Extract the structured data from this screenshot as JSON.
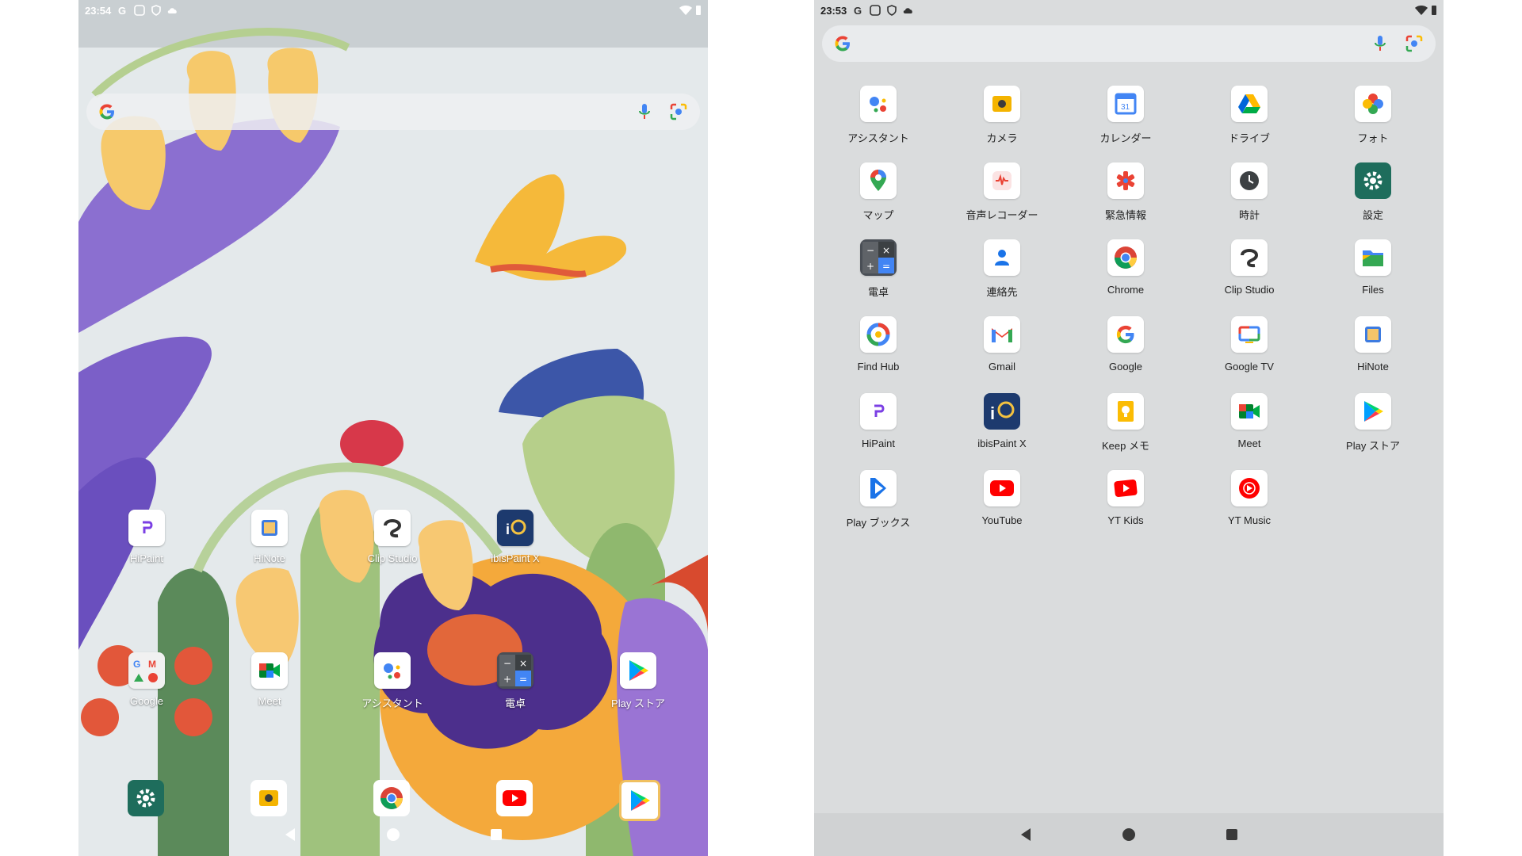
{
  "home": {
    "status_time": "23:54",
    "row1": [
      {
        "name": "hipaint",
        "label": "HiPaint",
        "icon": "hipaint-icon"
      },
      {
        "name": "hinote",
        "label": "HiNote",
        "icon": "hinote-icon"
      },
      {
        "name": "clip-studio",
        "label": "Clip Studio",
        "icon": "clip-studio-icon"
      },
      {
        "name": "ibispaint",
        "label": "ibisPaint X",
        "icon": "ibispaint-icon"
      }
    ],
    "row2": [
      {
        "name": "google-folder",
        "label": "Google",
        "icon": "google-folder-icon"
      },
      {
        "name": "meet",
        "label": "Meet",
        "icon": "meet-icon"
      },
      {
        "name": "assistant",
        "label": "アシスタント",
        "icon": "assistant-icon"
      },
      {
        "name": "calculator",
        "label": "電卓",
        "icon": "calculator-icon"
      },
      {
        "name": "play-store",
        "label": "Play ストア",
        "icon": "play-store-icon"
      }
    ],
    "dock": [
      "settings-icon",
      "camera-icon",
      "chrome-icon",
      "youtube-icon",
      "play-store-icon"
    ]
  },
  "drawer": {
    "status_time": "23:53",
    "apps": [
      {
        "label": "アシスタント",
        "icon": "assistant-icon"
      },
      {
        "label": "カメラ",
        "icon": "camera-icon"
      },
      {
        "label": "カレンダー",
        "icon": "calendar-icon"
      },
      {
        "label": "ドライブ",
        "icon": "drive-icon"
      },
      {
        "label": "フォト",
        "icon": "photos-icon"
      },
      {
        "label": "マップ",
        "icon": "maps-icon"
      },
      {
        "label": "音声レコーダー",
        "icon": "recorder-icon"
      },
      {
        "label": "緊急情報",
        "icon": "emergency-icon"
      },
      {
        "label": "時計",
        "icon": "clock-icon"
      },
      {
        "label": "設定",
        "icon": "settings-icon"
      },
      {
        "label": "電卓",
        "icon": "calculator-icon"
      },
      {
        "label": "連絡先",
        "icon": "contacts-icon"
      },
      {
        "label": "Chrome",
        "icon": "chrome-icon"
      },
      {
        "label": "Clip Studio",
        "icon": "clip-studio-icon"
      },
      {
        "label": "Files",
        "icon": "files-icon"
      },
      {
        "label": "Find Hub",
        "icon": "find-hub-icon"
      },
      {
        "label": "Gmail",
        "icon": "gmail-icon"
      },
      {
        "label": "Google",
        "icon": "google-icon"
      },
      {
        "label": "Google TV",
        "icon": "google-tv-icon"
      },
      {
        "label": "HiNote",
        "icon": "hinote-icon"
      },
      {
        "label": "HiPaint",
        "icon": "hipaint-icon"
      },
      {
        "label": "ibisPaint X",
        "icon": "ibispaint-icon"
      },
      {
        "label": "Keep メモ",
        "icon": "keep-icon"
      },
      {
        "label": "Meet",
        "icon": "meet-icon"
      },
      {
        "label": "Play ストア",
        "icon": "play-store-icon"
      },
      {
        "label": "Play ブックス",
        "icon": "play-books-icon"
      },
      {
        "label": "YouTube",
        "icon": "youtube-icon"
      },
      {
        "label": "YT Kids",
        "icon": "yt-kids-icon"
      },
      {
        "label": "YT Music",
        "icon": "yt-music-icon"
      }
    ]
  }
}
